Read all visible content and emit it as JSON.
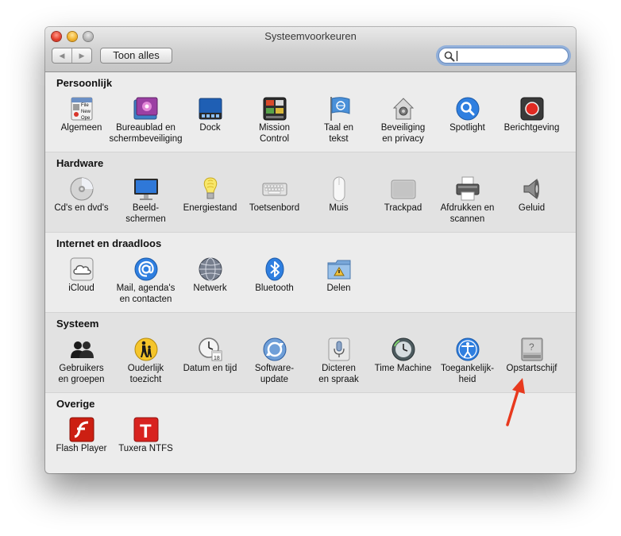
{
  "window": {
    "title": "Systeemvoorkeuren"
  },
  "toolbar": {
    "back_glyph": "◀",
    "forward_glyph": "▶",
    "show_all_label": "Toon alles",
    "search_value": ""
  },
  "sections": {
    "personal": {
      "title": "Persoonlijk",
      "items": [
        {
          "label": "Algemeen",
          "icon": "general-icon"
        },
        {
          "label": "Bureaublad en\nschermbeveiliging",
          "icon": "desktop-screensaver-icon"
        },
        {
          "label": "Dock",
          "icon": "dock-icon"
        },
        {
          "label": "Mission\nControl",
          "icon": "mission-control-icon"
        },
        {
          "label": "Taal en\ntekst",
          "icon": "language-flag-icon"
        },
        {
          "label": "Beveiliging\nen privacy",
          "icon": "security-house-icon"
        },
        {
          "label": "Spotlight",
          "icon": "spotlight-icon"
        },
        {
          "label": "Berichtgeving",
          "icon": "notifications-icon"
        }
      ]
    },
    "hardware": {
      "title": "Hardware",
      "items": [
        {
          "label": "Cd's en dvd's",
          "icon": "cd-dvd-icon"
        },
        {
          "label": "Beeld-\nschermen",
          "icon": "displays-icon"
        },
        {
          "label": "Energiestand",
          "icon": "energy-bulb-icon"
        },
        {
          "label": "Toetsenbord",
          "icon": "keyboard-icon"
        },
        {
          "label": "Muis",
          "icon": "mouse-icon"
        },
        {
          "label": "Trackpad",
          "icon": "trackpad-icon"
        },
        {
          "label": "Afdrukken en\nscannen",
          "icon": "printer-icon"
        },
        {
          "label": "Geluid",
          "icon": "speaker-icon"
        }
      ]
    },
    "internet": {
      "title": "Internet en draadloos",
      "items": [
        {
          "label": "iCloud",
          "icon": "icloud-icon"
        },
        {
          "label": "Mail, agenda's\nen contacten",
          "icon": "mail-at-icon"
        },
        {
          "label": "Netwerk",
          "icon": "network-globe-icon"
        },
        {
          "label": "Bluetooth",
          "icon": "bluetooth-icon"
        },
        {
          "label": "Delen",
          "icon": "sharing-folder-icon"
        }
      ]
    },
    "system": {
      "title": "Systeem",
      "items": [
        {
          "label": "Gebruikers\nen groepen",
          "icon": "users-icon"
        },
        {
          "label": "Ouderlijk\ntoezicht",
          "icon": "parental-controls-icon"
        },
        {
          "label": "Datum en tijd",
          "icon": "date-time-clock-icon"
        },
        {
          "label": "Software-\nupdate",
          "icon": "software-update-icon"
        },
        {
          "label": "Dicteren\nen spraak",
          "icon": "dictation-microphone-icon"
        },
        {
          "label": "Time Machine",
          "icon": "time-machine-icon"
        },
        {
          "label": "Toegankelijk-\nheid",
          "icon": "accessibility-icon"
        },
        {
          "label": "Opstartschijf",
          "icon": "startup-disk-icon"
        }
      ]
    },
    "other": {
      "title": "Overige",
      "items": [
        {
          "label": "Flash Player",
          "icon": "flash-player-icon"
        },
        {
          "label": "Tuxera NTFS",
          "icon": "tuxera-ntfs-icon"
        }
      ]
    }
  },
  "icon_text": {
    "general_file": "File",
    "general_new": "New",
    "general_open": "Ope",
    "calendar_day": "18",
    "tuxera_letter": "T"
  },
  "colors": {
    "accent_blue": "#2f7fe0",
    "annotation_arrow": "#e8391e",
    "flash_red": "#cc1f12",
    "tuxera_red": "#d8231f"
  }
}
